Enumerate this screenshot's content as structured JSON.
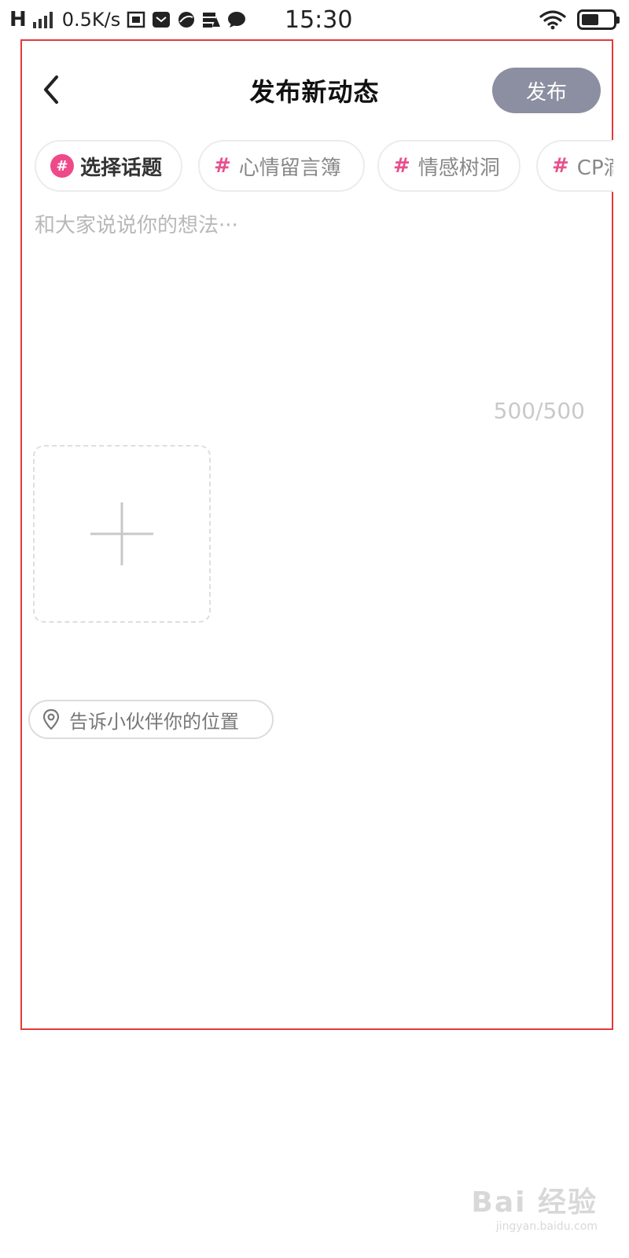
{
  "status_bar": {
    "network": "H",
    "speed": "0.5K/s",
    "time": "15:30",
    "battery_level": 0.55,
    "icons": [
      "hd-icon",
      "mail-icon",
      "browser-icon",
      "storage-warning-icon",
      "chat-bubble-icon",
      "wifi-icon",
      "battery-icon"
    ]
  },
  "header": {
    "title": "发布新动态",
    "publish_label": "发布",
    "back_icon": "chevron-left-icon"
  },
  "topics": {
    "select_label": "选择话题",
    "chips": [
      "心情留言簿",
      "情感树洞",
      "CP滴"
    ]
  },
  "composer": {
    "placeholder": "和大家说说你的想法···",
    "counter": "500/500"
  },
  "media": {
    "add_icon": "plus-icon"
  },
  "location": {
    "label": "告诉小伙伴你的位置",
    "icon": "location-pin-icon"
  },
  "watermark": {
    "main": "Bai 经验",
    "sub": "jingyan.baidu.com"
  },
  "colors": {
    "accent": "#e8508e",
    "publish_bg": "#8c8fa1",
    "annotation": "#e23a3a"
  }
}
